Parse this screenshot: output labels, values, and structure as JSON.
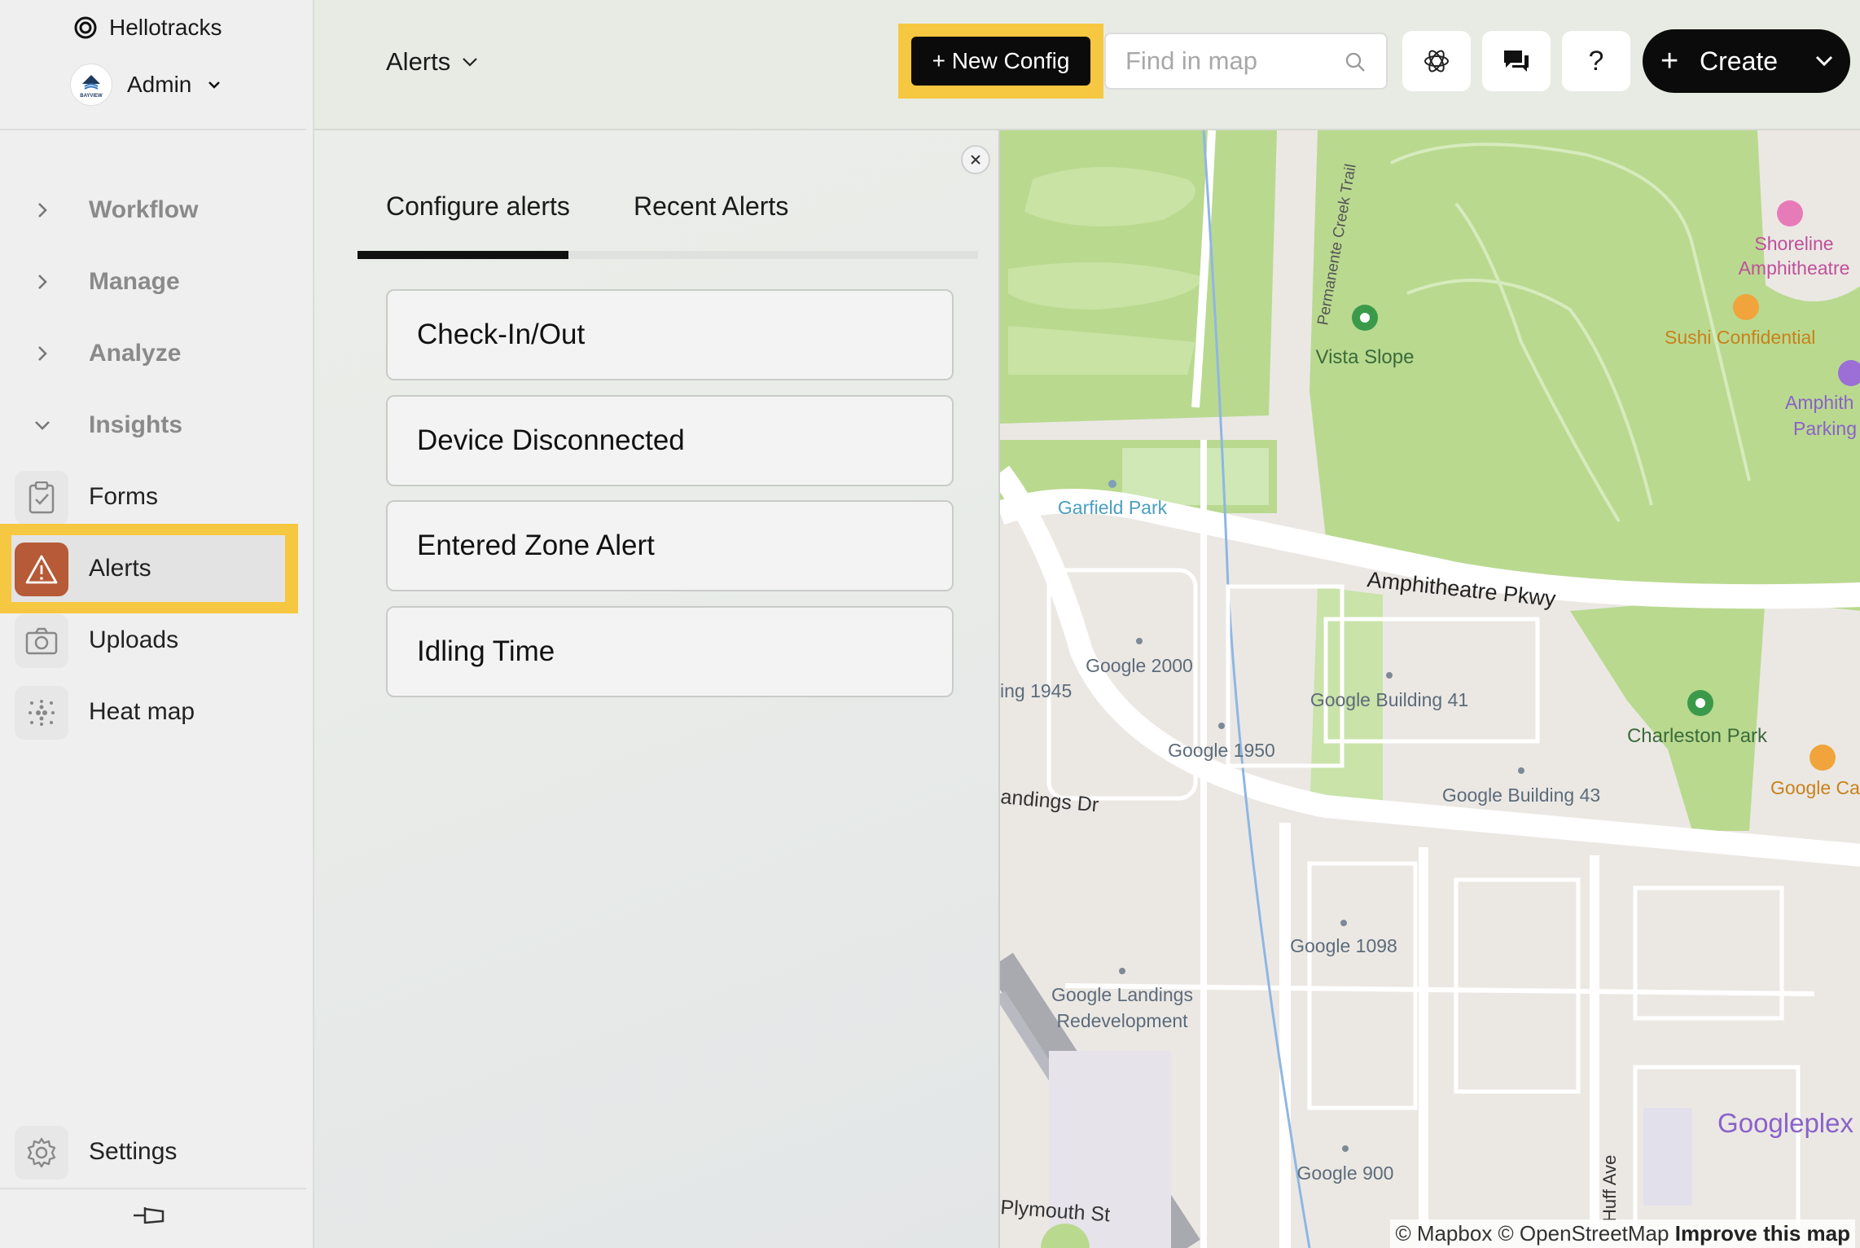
{
  "app": {
    "brand": "Hellotracks",
    "account_name": "Admin",
    "avatar_text": "BAYVIEW"
  },
  "sidebar": {
    "groups": [
      {
        "label": "Workflow",
        "expanded": false
      },
      {
        "label": "Manage",
        "expanded": false
      },
      {
        "label": "Analyze",
        "expanded": false
      },
      {
        "label": "Insights",
        "expanded": true
      }
    ],
    "items": [
      {
        "label": "Forms",
        "icon": "clipboard-icon"
      },
      {
        "label": "Alerts",
        "icon": "warning-icon",
        "active": true
      },
      {
        "label": "Uploads",
        "icon": "camera-icon"
      },
      {
        "label": "Heat map",
        "icon": "dots-grid-icon"
      }
    ],
    "settings_label": "Settings"
  },
  "topbar": {
    "view_label": "Alerts",
    "new_config_label": "+ New Config",
    "search_placeholder": "Find in map",
    "help_label": "?",
    "create_label": "Create"
  },
  "panel": {
    "tabs": [
      {
        "label": "Configure alerts",
        "active": true
      },
      {
        "label": "Recent Alerts",
        "active": false
      }
    ],
    "alerts": [
      "Check-In/Out",
      "Device Disconnected",
      "Entered Zone Alert",
      "Idling Time"
    ]
  },
  "map": {
    "labels": {
      "permanente": "Permanente Creek Trail",
      "shoreline": "Shoreline",
      "amphitheatre": "Amphitheatre",
      "sushi": "Sushi Confidential",
      "vista": "Vista Slope",
      "amph_parking_1": "Amphith",
      "amph_parking_2": "Parking",
      "garfield": "Garfield Park",
      "pkwy": "Amphitheatre Pkwy",
      "g2000": "Google 2000",
      "bldg1945": "ing 1945",
      "g41": "Google Building 41",
      "charleston": "Charleston Park",
      "g1950": "Google 1950",
      "gcafe": "Google Ca",
      "g43": "Google Building 43",
      "landings_dr": "andings Dr",
      "g1098": "Google 1098",
      "landings_1": "Google Landings",
      "landings_2": "Redevelopment",
      "googleplex": "Googleplex",
      "huff": "Huff Ave",
      "g900": "Google 900",
      "plymouth": "Plymouth St"
    },
    "attribution": "© Mapbox © OpenStreetMap",
    "improve_label": "Improve this map"
  },
  "colors": {
    "highlight": "#f6c740",
    "alerts_icon_bg": "#b65a37",
    "park_green": "#b9d98f",
    "road": "#ffffff"
  }
}
